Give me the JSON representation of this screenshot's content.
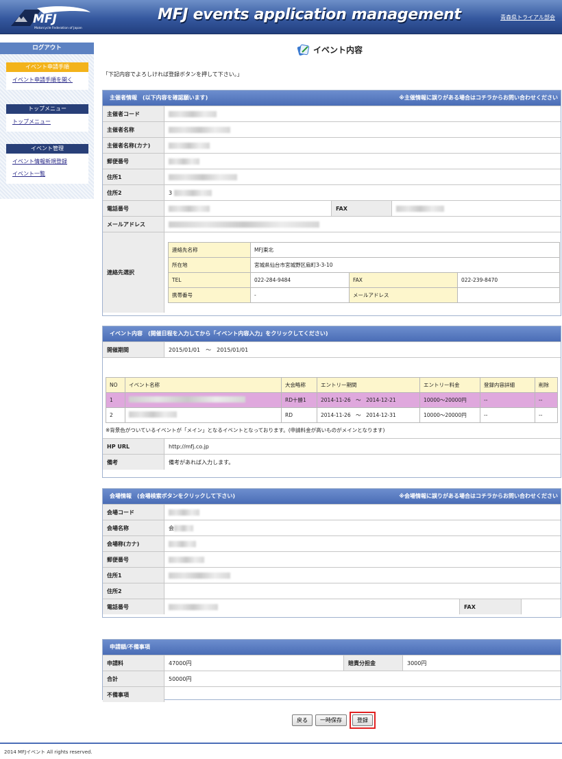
{
  "header": {
    "logo_text": "MFJ",
    "logo_subtext": "Motorcycle Federation of Japan",
    "title": "MFJ events application management",
    "user_label": "青森県トライアル部会"
  },
  "sidebar": {
    "logout": "ログアウト",
    "groups": [
      {
        "title": "イベント申請手順",
        "links": [
          "イベント申請手順を開く"
        ]
      },
      {
        "title": "トップメニュー",
        "links": [
          "トップメニュー"
        ]
      },
      {
        "title": "イベント管理",
        "links": [
          "イベント情報新規登録",
          "イベント一覧"
        ]
      }
    ]
  },
  "page": {
    "title": "イベント内容",
    "instruction": "「下記内容でよろしければ登録ボタンを押して下さい。」"
  },
  "organizer": {
    "header": "主催者情報　(以下内容を確認願います)",
    "header_note": "※主催情報に誤りがある場合はコチラからお問い合わせください",
    "labels": {
      "code": "主催者コード",
      "name": "主催者名称",
      "kana": "主催者名称(カナ)",
      "postal": "郵便番号",
      "address1": "住所1",
      "address2": "住所2",
      "phone": "電話番号",
      "fax": "FAX",
      "email": "メールアドレス",
      "contact": "連絡先選択"
    },
    "address2_prefix": "3",
    "contact": {
      "name_label": "連絡先名称",
      "name": "MFJ東北",
      "addr_label": "所在地",
      "addr": "宮城県仙台市宮城野区扇町3-3-10",
      "tel_label": "TEL",
      "tel": "022-284-9484",
      "fax_label": "FAX",
      "fax": "022-239-8470",
      "mobile_label": "携帯番号",
      "mobile": "-",
      "email_label": "メールアドレス",
      "email": ""
    }
  },
  "event": {
    "header": "イベント内容　(開催日程を入力してから「イベント内容入力」をクリックしてください)",
    "period_label": "開催期間",
    "period": "2015/01/01　～　2015/01/01",
    "columns": [
      "NO",
      "イベント名称",
      "大会略称",
      "エントリー期間",
      "エントリー料金",
      "登録内容詳細",
      "削除"
    ],
    "rows": [
      {
        "no": "1",
        "abbr": "RD十勝1",
        "entry_period": "2014-11-26　～　2014-12-21",
        "fee": "10000～20000円",
        "detail": "--",
        "delete": "--"
      },
      {
        "no": "2",
        "abbr": "RD",
        "entry_period": "2014-11-26　～　2014-12-31",
        "fee": "10000～20000円",
        "detail": "--",
        "delete": "--"
      }
    ],
    "note": "※背景色がついているイベントが「メイン」となるイベントとなっております。(申請料金が高いものがメインとなります)",
    "hp_label": "HP URL",
    "hp": "http://mfj.co.jp",
    "remarks_label": "備考",
    "remarks": "備考があれば入力します。"
  },
  "venue": {
    "header": "会場情報　(会場検索ボタンをクリックして下さい)",
    "header_note": "※会場情報に誤りがある場合はコチラからお問い合わせください",
    "labels": {
      "code": "会場コード",
      "name": "会場名称",
      "kana": "会場称(カナ)",
      "postal": "郵便番号",
      "address1": "住所1",
      "address2": "住所2",
      "phone": "電話番号",
      "fax": "FAX"
    },
    "name_prefix": "会"
  },
  "fees": {
    "header": "申請額/不備事項",
    "fee_label": "申請料",
    "fee": "47000円",
    "share_label": "賠責分担金",
    "share": "3000円",
    "total_label": "合計",
    "total": "50000円",
    "defects_label": "不備事項"
  },
  "buttons": {
    "back": "戻る",
    "temp_save": "一時保存",
    "register": "登録"
  },
  "footer": "2014 MFJイベント All rights reserved.",
  "colors": {
    "header_blue": "#35589f",
    "section_head": "#5a7cc0",
    "highlight_row": "#dfa8dd",
    "highlight_button_border": "#e02020"
  }
}
